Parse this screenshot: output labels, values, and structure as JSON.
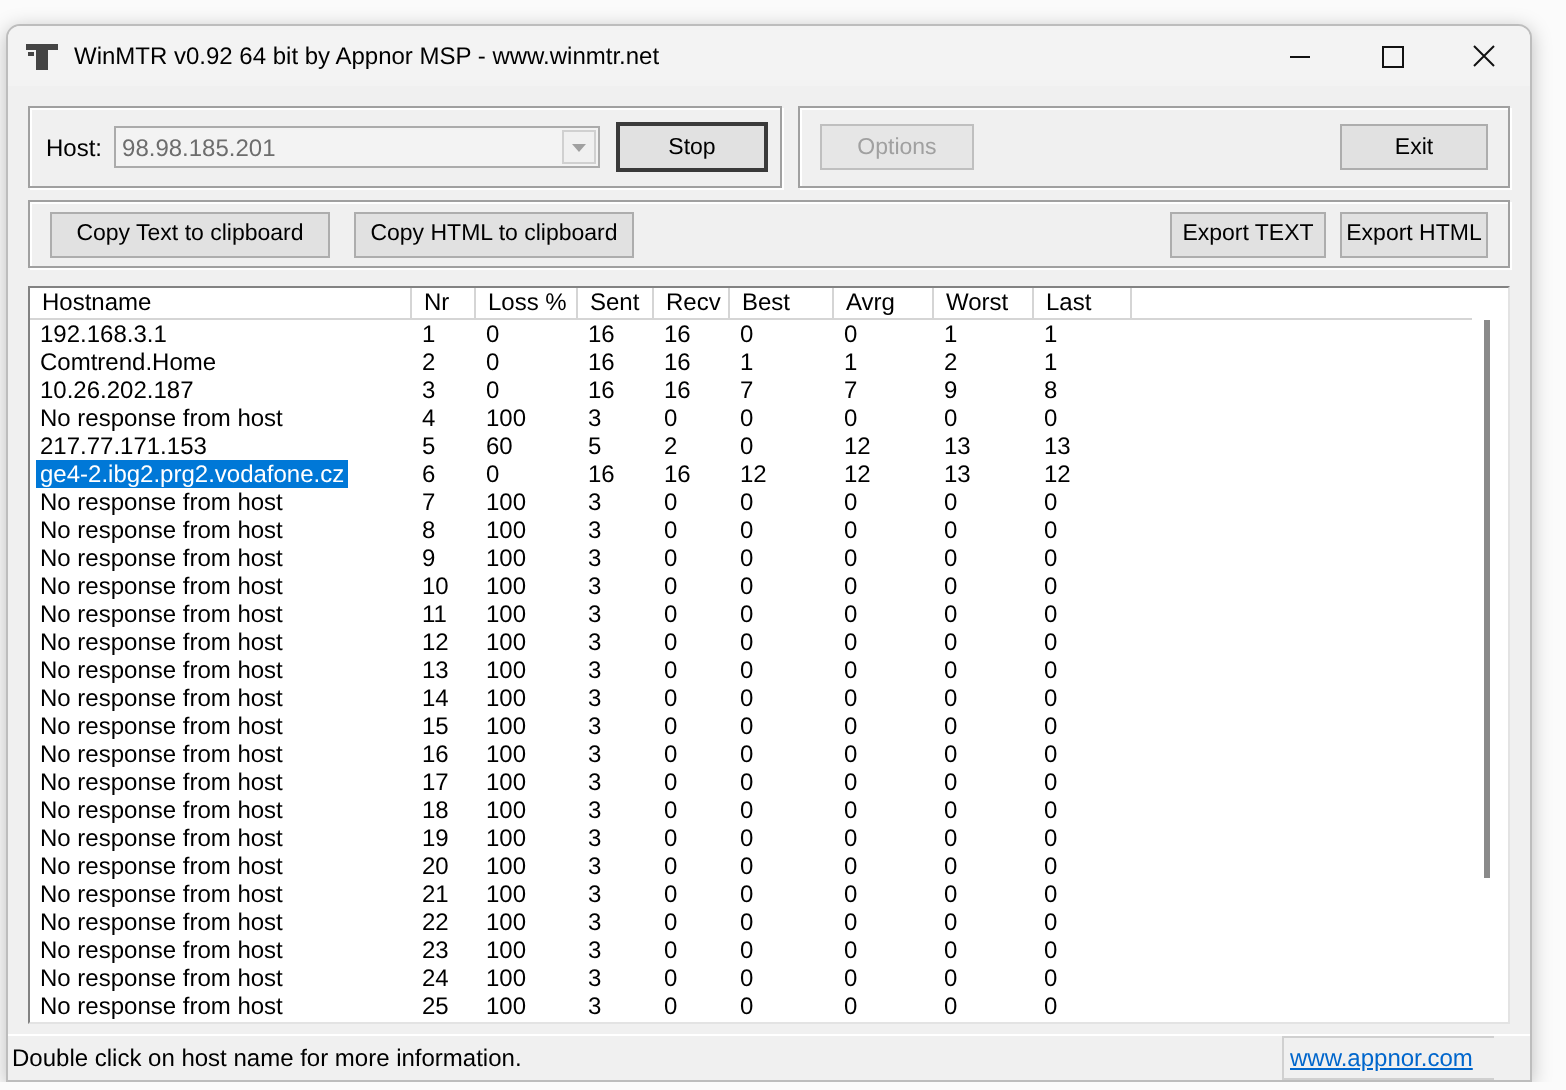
{
  "window": {
    "title": "WinMTR v0.92 64 bit by Appnor MSP - www.winmtr.net"
  },
  "host": {
    "label": "Host:",
    "value": "98.98.185.201",
    "disabled": true
  },
  "top_buttons": [
    {
      "label": "Stop",
      "disabled": false,
      "default": true
    },
    {
      "label": "Options",
      "disabled": true,
      "default": false
    },
    {
      "label": "Exit",
      "disabled": false,
      "default": false
    }
  ],
  "copy_buttons": [
    {
      "label": "Copy Text to clipboard"
    },
    {
      "label": "Copy HTML to clipboard"
    }
  ],
  "export_buttons": [
    {
      "label": "Export TEXT"
    },
    {
      "label": "Export HTML"
    }
  ],
  "table": {
    "columns": [
      "Hostname",
      "Nr",
      "Loss %",
      "Sent",
      "Recv",
      "Best",
      "Avrg",
      "Worst",
      "Last"
    ],
    "rows": [
      {
        "cells": [
          "192.168.3.1",
          "1",
          "0",
          "16",
          "16",
          "0",
          "0",
          "1",
          "1"
        ],
        "selected": false
      },
      {
        "cells": [
          "Comtrend.Home",
          "2",
          "0",
          "16",
          "16",
          "1",
          "1",
          "2",
          "1"
        ],
        "selected": false
      },
      {
        "cells": [
          "10.26.202.187",
          "3",
          "0",
          "16",
          "16",
          "7",
          "7",
          "9",
          "8"
        ],
        "selected": false
      },
      {
        "cells": [
          "No response from host",
          "4",
          "100",
          "3",
          "0",
          "0",
          "0",
          "0",
          "0"
        ],
        "selected": false
      },
      {
        "cells": [
          "217.77.171.153",
          "5",
          "60",
          "5",
          "2",
          "0",
          "12",
          "13",
          "13"
        ],
        "selected": false
      },
      {
        "cells": [
          "ge4-2.ibg2.prg2.vodafone.cz",
          "6",
          "0",
          "16",
          "16",
          "12",
          "12",
          "13",
          "12"
        ],
        "selected": true
      },
      {
        "cells": [
          "No response from host",
          "7",
          "100",
          "3",
          "0",
          "0",
          "0",
          "0",
          "0"
        ],
        "selected": false
      },
      {
        "cells": [
          "No response from host",
          "8",
          "100",
          "3",
          "0",
          "0",
          "0",
          "0",
          "0"
        ],
        "selected": false
      },
      {
        "cells": [
          "No response from host",
          "9",
          "100",
          "3",
          "0",
          "0",
          "0",
          "0",
          "0"
        ],
        "selected": false
      },
      {
        "cells": [
          "No response from host",
          "10",
          "100",
          "3",
          "0",
          "0",
          "0",
          "0",
          "0"
        ],
        "selected": false
      },
      {
        "cells": [
          "No response from host",
          "11",
          "100",
          "3",
          "0",
          "0",
          "0",
          "0",
          "0"
        ],
        "selected": false
      },
      {
        "cells": [
          "No response from host",
          "12",
          "100",
          "3",
          "0",
          "0",
          "0",
          "0",
          "0"
        ],
        "selected": false
      },
      {
        "cells": [
          "No response from host",
          "13",
          "100",
          "3",
          "0",
          "0",
          "0",
          "0",
          "0"
        ],
        "selected": false
      },
      {
        "cells": [
          "No response from host",
          "14",
          "100",
          "3",
          "0",
          "0",
          "0",
          "0",
          "0"
        ],
        "selected": false
      },
      {
        "cells": [
          "No response from host",
          "15",
          "100",
          "3",
          "0",
          "0",
          "0",
          "0",
          "0"
        ],
        "selected": false
      },
      {
        "cells": [
          "No response from host",
          "16",
          "100",
          "3",
          "0",
          "0",
          "0",
          "0",
          "0"
        ],
        "selected": false
      },
      {
        "cells": [
          "No response from host",
          "17",
          "100",
          "3",
          "0",
          "0",
          "0",
          "0",
          "0"
        ],
        "selected": false
      },
      {
        "cells": [
          "No response from host",
          "18",
          "100",
          "3",
          "0",
          "0",
          "0",
          "0",
          "0"
        ],
        "selected": false
      },
      {
        "cells": [
          "No response from host",
          "19",
          "100",
          "3",
          "0",
          "0",
          "0",
          "0",
          "0"
        ],
        "selected": false
      },
      {
        "cells": [
          "No response from host",
          "20",
          "100",
          "3",
          "0",
          "0",
          "0",
          "0",
          "0"
        ],
        "selected": false
      },
      {
        "cells": [
          "No response from host",
          "21",
          "100",
          "3",
          "0",
          "0",
          "0",
          "0",
          "0"
        ],
        "selected": false
      },
      {
        "cells": [
          "No response from host",
          "22",
          "100",
          "3",
          "0",
          "0",
          "0",
          "0",
          "0"
        ],
        "selected": false
      },
      {
        "cells": [
          "No response from host",
          "23",
          "100",
          "3",
          "0",
          "0",
          "0",
          "0",
          "0"
        ],
        "selected": false
      },
      {
        "cells": [
          "No response from host",
          "24",
          "100",
          "3",
          "0",
          "0",
          "0",
          "0",
          "0"
        ],
        "selected": false
      },
      {
        "cells": [
          "No response from host",
          "25",
          "100",
          "3",
          "0",
          "0",
          "0",
          "0",
          "0"
        ],
        "selected": false
      }
    ]
  },
  "status_bar": {
    "text": "Double click on host name for more information.",
    "link": "www.appnor.com"
  }
}
